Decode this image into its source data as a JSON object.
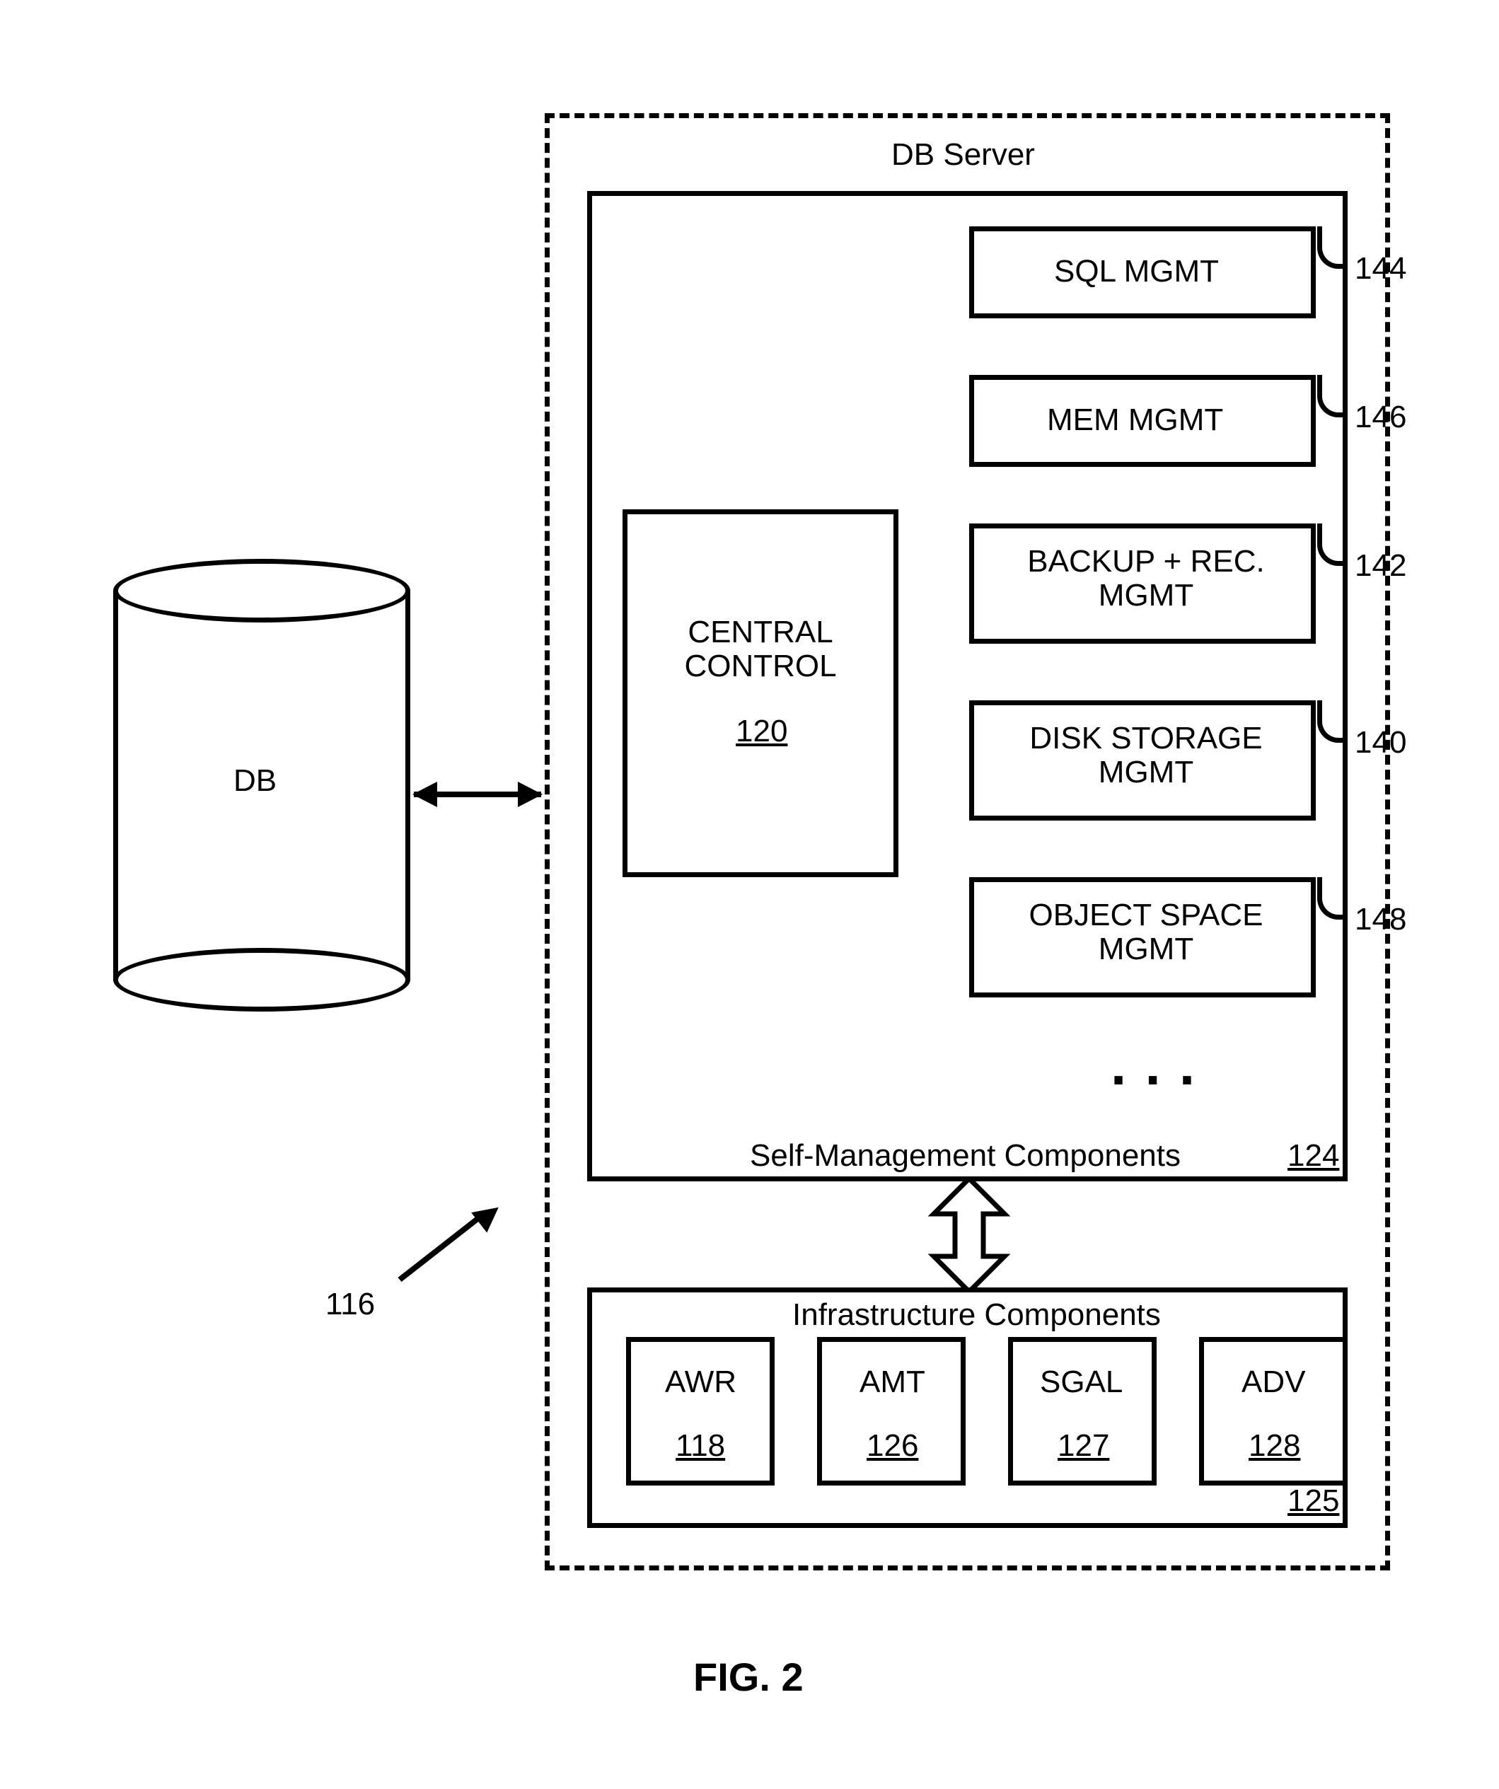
{
  "figure_label": "FIG. 2",
  "system_ref": "116",
  "db": {
    "label": "DB"
  },
  "server": {
    "title": "DB Server",
    "self_mgmt": {
      "label": "Self-Management Components",
      "ref": "124",
      "central": {
        "label": "CENTRAL CONTROL",
        "ref": "120"
      },
      "modules": [
        {
          "label": "SQL MGMT",
          "ref": "144"
        },
        {
          "label": "MEM MGMT",
          "ref": "146"
        },
        {
          "label": "BACKUP + REC. MGMT",
          "ref": "142"
        },
        {
          "label": "DISK STORAGE MGMT",
          "ref": "140"
        },
        {
          "label": "OBJECT SPACE MGMT",
          "ref": "148"
        }
      ],
      "ellipsis": ". . ."
    },
    "infra": {
      "label": "Infrastructure Components",
      "ref": "125",
      "items": [
        {
          "label": "AWR",
          "ref": "118"
        },
        {
          "label": "AMT",
          "ref": "126"
        },
        {
          "label": "SGAL",
          "ref": "127"
        },
        {
          "label": "ADV",
          "ref": "128"
        }
      ]
    }
  }
}
